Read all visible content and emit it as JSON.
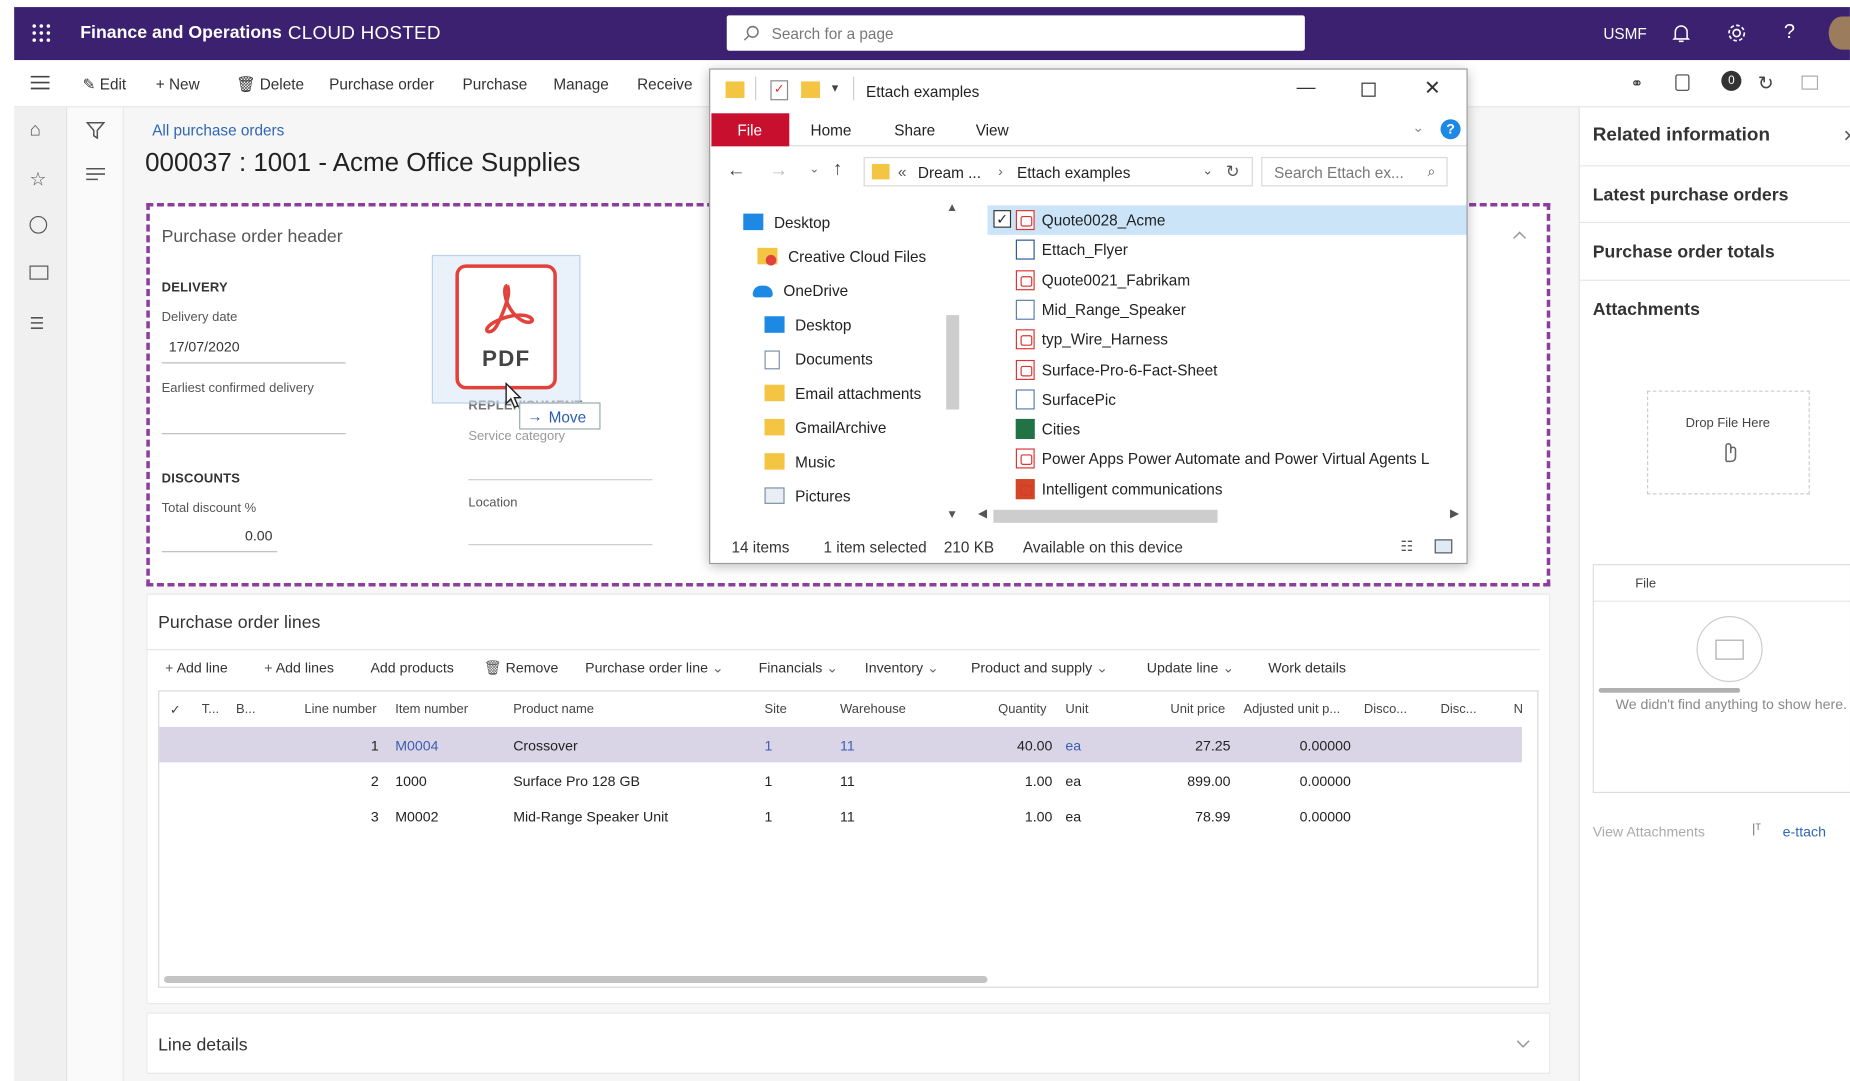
{
  "topbar": {
    "brand": "Finance and Operations",
    "environment": "CLOUD HOSTED",
    "search_placeholder": "Search for a page",
    "company": "USMF"
  },
  "actions": {
    "edit": "Edit",
    "new": "New",
    "delete": "Delete",
    "purchase_order": "Purchase order",
    "purchase": "Purchase",
    "manage": "Manage",
    "receive": "Receive",
    "badge_count": "0"
  },
  "page": {
    "breadcrumb": "All purchase orders",
    "title": "000037 : 1001 - Acme Office Supplies"
  },
  "header_section": {
    "title": "Purchase order header",
    "delivery_heading": "DELIVERY",
    "delivery_date_label": "Delivery date",
    "delivery_date_value": "17/07/2020",
    "earliest_label": "Earliest confirmed delivery",
    "discounts_heading": "DISCOUNTS",
    "total_discount_label": "Total discount %",
    "total_discount_value": "0.00",
    "replenishment_heading": "REPLENISHMENT",
    "service_category_label": "Service category",
    "location_label": "Location",
    "drag_pdf_label": "PDF",
    "drag_tooltip": "Move"
  },
  "lines_section": {
    "title": "Purchase order lines",
    "toolbar": [
      "Add line",
      "Add lines",
      "Add products",
      "Remove",
      "Purchase order line",
      "Financials",
      "Inventory",
      "Product and supply",
      "Update line",
      "Work details"
    ],
    "columns": [
      "T...",
      "B...",
      "Line number",
      "Item number",
      "Product name",
      "Site",
      "Warehouse",
      "Quantity",
      "Unit",
      "Unit price",
      "Adjusted unit p...",
      "Disco...",
      "Disc...",
      "N"
    ],
    "rows": [
      {
        "line": "1",
        "item": "M0004",
        "product": "Crossover",
        "site": "1",
        "warehouse": "11",
        "qty": "40.00",
        "unit": "ea",
        "price": "27.25",
        "adjusted": "0.00000"
      },
      {
        "line": "2",
        "item": "1000",
        "product": "Surface Pro 128 GB",
        "site": "1",
        "warehouse": "11",
        "qty": "1.00",
        "unit": "ea",
        "price": "899.00",
        "adjusted": "0.00000"
      },
      {
        "line": "3",
        "item": "M0002",
        "product": "Mid-Range Speaker Unit",
        "site": "1",
        "warehouse": "11",
        "qty": "1.00",
        "unit": "ea",
        "price": "78.99",
        "adjusted": "0.00000"
      }
    ]
  },
  "line_details": {
    "title": "Line details"
  },
  "explorer": {
    "title": "Ettach examples",
    "tabs": [
      "File",
      "Home",
      "Share",
      "View"
    ],
    "address": [
      "Dream ...",
      "Ettach examples"
    ],
    "search_placeholder": "Search Ettach ex...",
    "tree": [
      "Desktop",
      "Creative Cloud Files",
      "OneDrive",
      "Desktop",
      "Documents",
      "Email attachments",
      "GmailArchive",
      "Music",
      "Pictures"
    ],
    "files": [
      {
        "name": "Quote0028_Acme",
        "icon": "pdf-icon"
      },
      {
        "name": "Ettach_Flyer",
        "icon": "word-icon"
      },
      {
        "name": "Quote0021_Fabrikam",
        "icon": "pdf-icon"
      },
      {
        "name": "Mid_Range_Speaker",
        "icon": "image-icon"
      },
      {
        "name": "typ_Wire_Harness",
        "icon": "pdf-icon"
      },
      {
        "name": "Surface-Pro-6-Fact-Sheet",
        "icon": "pdf-icon"
      },
      {
        "name": "SurfacePic",
        "icon": "image-icon"
      },
      {
        "name": "Cities",
        "icon": "excel-icon"
      },
      {
        "name": "Power Apps Power Automate and Power Virtual Agents L",
        "icon": "pdf-icon"
      },
      {
        "name": "Intelligent  communications",
        "icon": "powerpoint-icon"
      }
    ],
    "status_items": "14 items",
    "status_selected": "1 item selected",
    "status_size": "210 KB",
    "status_availability": "Available on this device"
  },
  "related_panel": {
    "title": "Related information",
    "sections": [
      "Latest purchase orders",
      "Purchase order totals",
      "Attachments"
    ],
    "drop_label": "Drop File Here",
    "file_column": "File",
    "empty_message": "We didn't find anything to show here.",
    "view_attachments": "View Attachments",
    "ettach_link": "e-ttach"
  }
}
